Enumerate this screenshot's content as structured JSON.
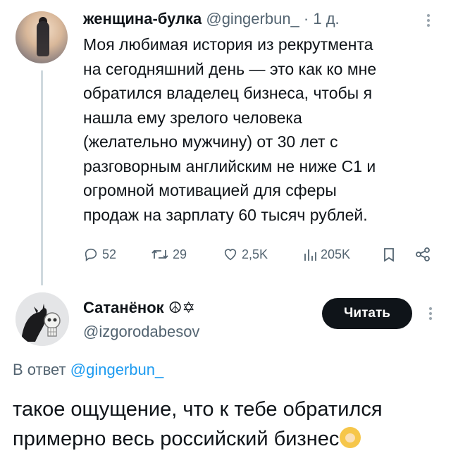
{
  "tweet1": {
    "author_name": "женщина-булка",
    "handle": "@gingerbun_",
    "separator": "·",
    "time": "1 д.",
    "text_lines": [
      "Моя любимая история из рекрутмента",
      "на сегодняшний день — это как ко мне",
      "обратился владелец бизнеса, чтобы я",
      "нашла ему зрелого человека",
      "(желательно мужчину) от 30 лет с",
      "разговорным английским не ниже С1 и",
      "огромной мотивацией для сферы",
      "продаж на зарплату 60 тысяч рублей."
    ],
    "replies": "52",
    "retweets": "29",
    "likes": "2,5K",
    "views": "205K"
  },
  "tweet2": {
    "author_name": "Сатанёнок ☮✡",
    "handle": "@izgorodabesov",
    "follow_label": "Читать",
    "reply_prefix": "В ответ",
    "reply_handle": "@gingerbun_",
    "text_lines": [
      "такое ощущение, что к тебе обратился",
      "примерно весь российский бизнес"
    ]
  },
  "icons": {
    "reply": "reply-icon",
    "retweet": "retweet-icon",
    "like": "heart-icon",
    "views": "views-chart-icon",
    "bookmark": "bookmark-icon",
    "share": "share-icon",
    "more": "more-dots-icon",
    "emoji": "person-raising-hands-emoji"
  },
  "colors": {
    "text": "#0f1419",
    "secondary": "#536471",
    "link": "#1d9bf0",
    "button_bg": "#0f1419",
    "thread_line": "#cfd9de"
  }
}
